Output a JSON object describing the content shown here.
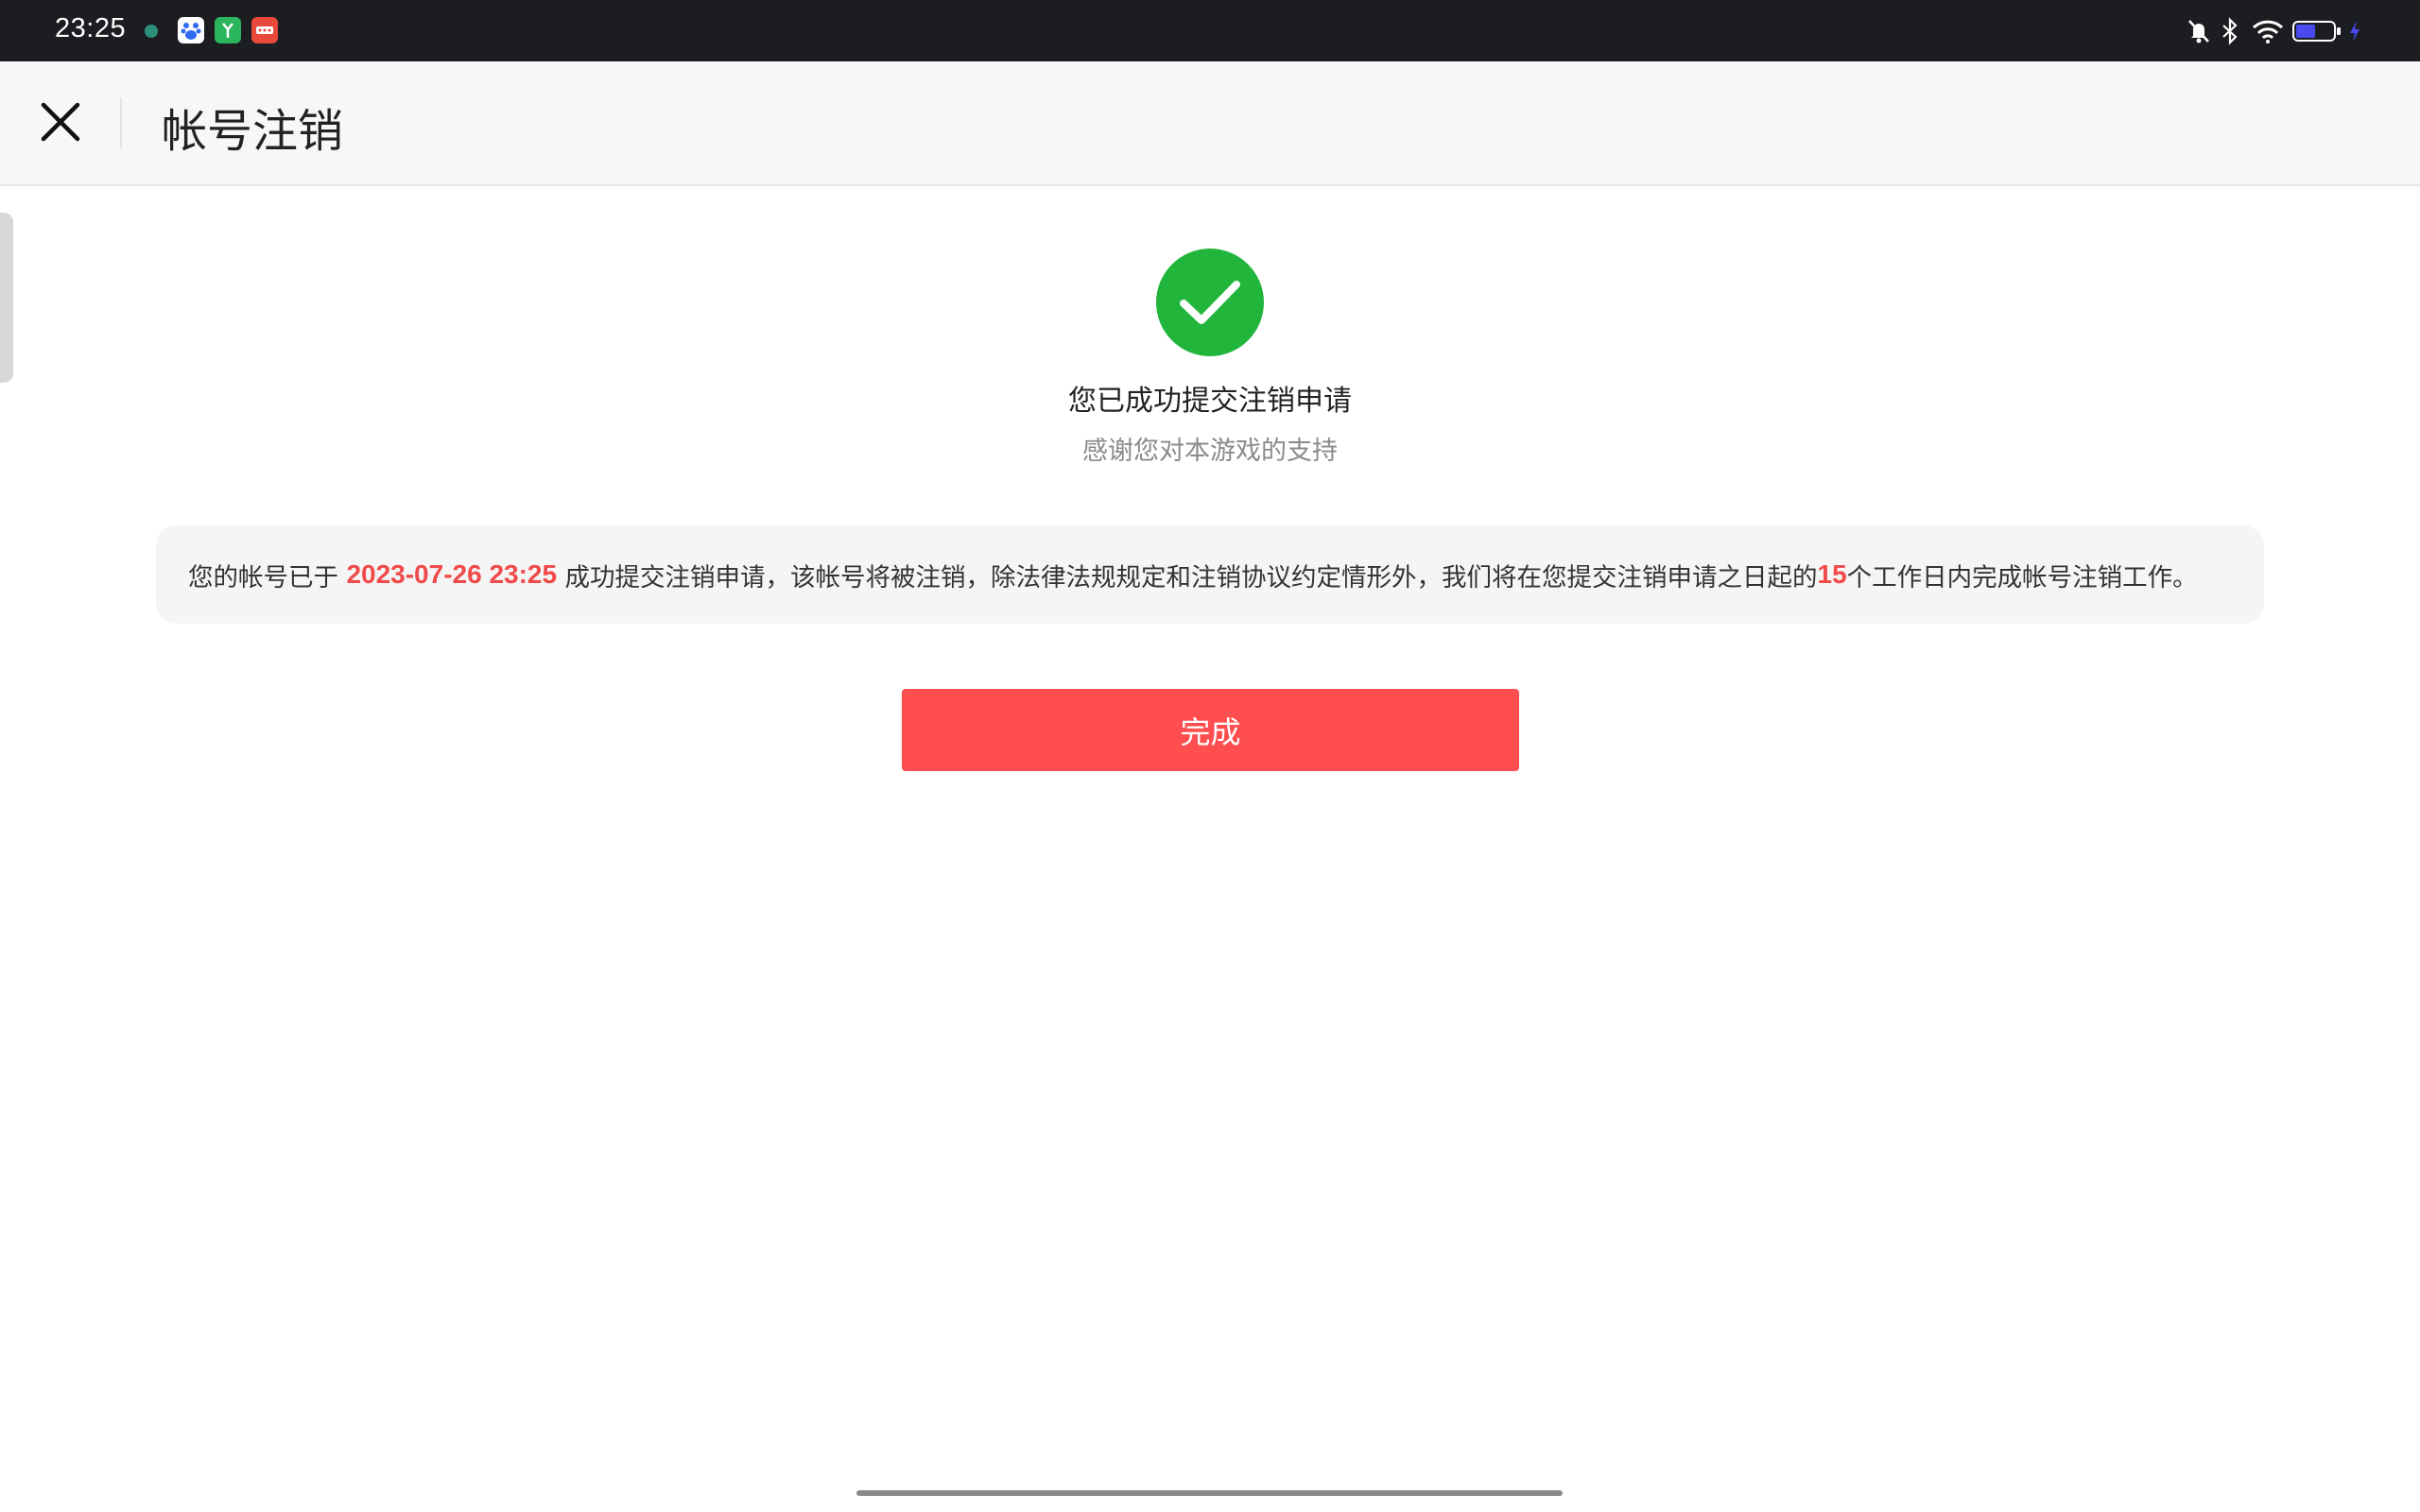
{
  "status_bar": {
    "time": "23:25",
    "notification_icons": [
      {
        "name": "app-icon-1",
        "color": "#2d8f7b"
      },
      {
        "name": "baidu-icon",
        "color": "#2f6bf0"
      },
      {
        "name": "green-app-icon",
        "color": "#2bb55c"
      },
      {
        "name": "red-app-icon",
        "color": "#e8493a"
      }
    ],
    "system_icons": [
      "mute-icon",
      "bluetooth-icon",
      "wifi-icon",
      "battery-icon",
      "charging-icon"
    ],
    "battery_color": "#4a4af0"
  },
  "header": {
    "title": "帐号注销",
    "close_icon": "close-icon"
  },
  "success": {
    "icon": "checkmark-icon",
    "icon_color": "#22b53c",
    "title": "您已成功提交注销申请",
    "subtitle": "感谢您对本游戏的支持"
  },
  "notice": {
    "prefix": "您的帐号已于 ",
    "datetime": "2023-07-26 23:25",
    "middle": " 成功提交注销申请，该帐号将被注销，除法律法规规定和注销协议约定情形外，我们将在您提交注销申请之日起的",
    "days": "15",
    "suffix": "个工作日内完成帐号注销工作。",
    "highlight_color": "#f04a4a"
  },
  "actions": {
    "done_label": "完成",
    "button_color": "#ff4e50"
  }
}
